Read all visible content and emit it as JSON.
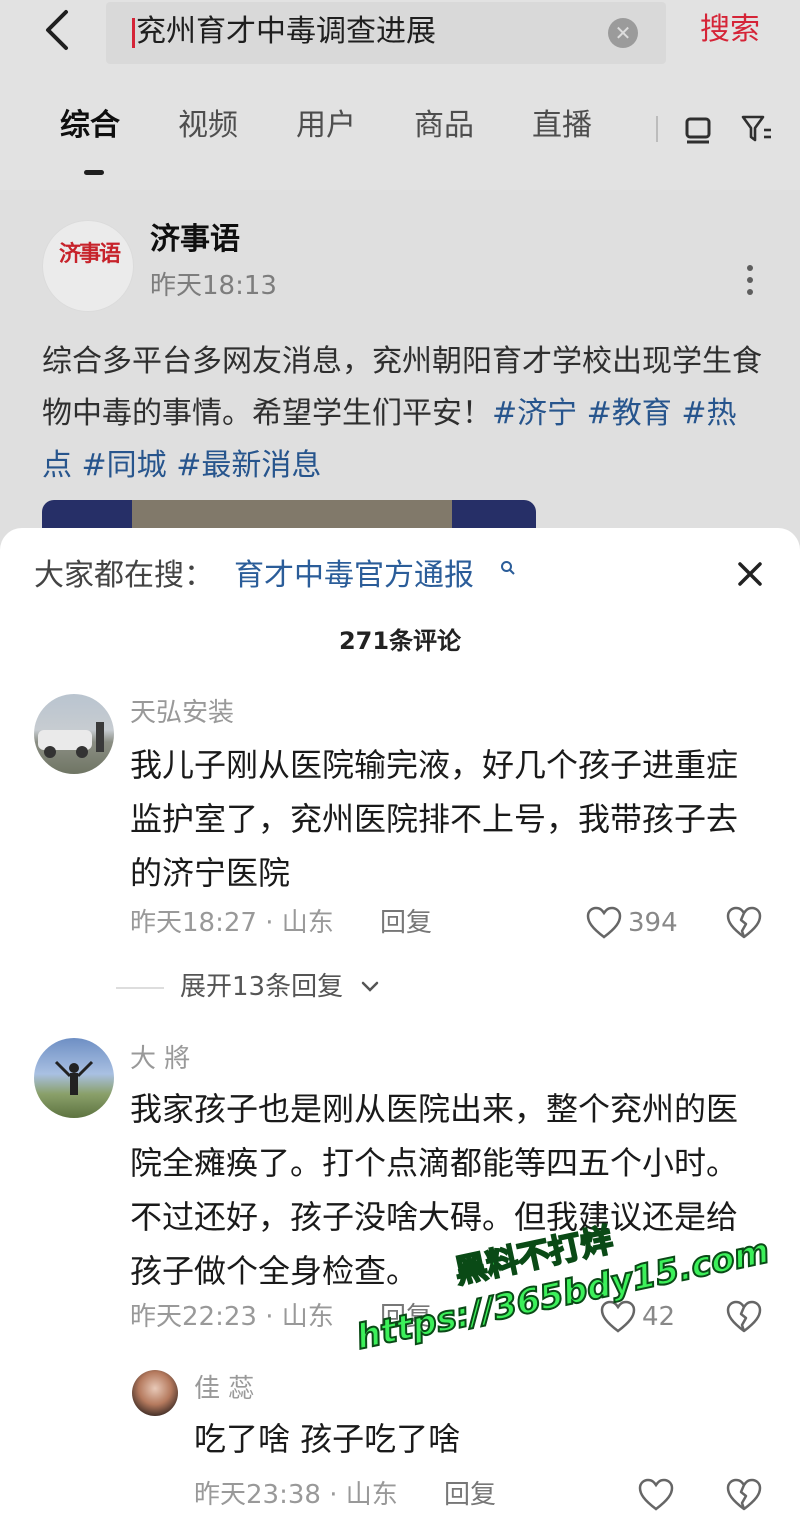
{
  "search": {
    "query": "兖州育才中毒调查进展",
    "clear_icon": "clear-icon",
    "button_label": "搜索"
  },
  "tabs": [
    {
      "label": "综合",
      "active": true
    },
    {
      "label": "视频",
      "active": false
    },
    {
      "label": "用户",
      "active": false
    },
    {
      "label": "商品",
      "active": false
    },
    {
      "label": "直播",
      "active": false
    }
  ],
  "post": {
    "author": "济事语",
    "avatar_text": "济事语",
    "time": "昨天18:13",
    "text": "综合多平台多网友消息，兖州朝阳育才学校出现学生食物中毒的事情。希望学生们平安！",
    "tags": "#济宁 #教育 #热点 #同城 #最新消息"
  },
  "sheet": {
    "trending_label": "大家都在搜：",
    "trending_link": "育才中毒官方通报",
    "comment_count": "271条评论"
  },
  "comments": [
    {
      "author": "天弘安装",
      "text": "我儿子刚从医院输完液，好几个孩子进重症监护室了，兖州医院排不上号，我带孩子去的济宁医院",
      "time_location": "昨天18:27 · 山东",
      "reply_label": "回复",
      "likes": "394",
      "expand_label": "展开13条回复"
    },
    {
      "author": "大 將",
      "text": "我家孩子也是刚从医院出来，整个兖州的医院全瘫痪了。打个点滴都能等四五个小时。不过还好，孩子没啥大碍。但我建议还是给孩子做个全身检查。",
      "time_location": "昨天22:23 · 山东",
      "reply_label": "回复",
      "likes": "42"
    },
    {
      "author": "佳 蕊",
      "text": "吃了啥 孩子吃了啥",
      "time_location": "昨天23:38 · 山东",
      "reply_label": "回复",
      "likes": ""
    }
  ],
  "watermark": {
    "line1": "黑料不打烊",
    "line2": "https://365bdy15.com"
  },
  "colors": {
    "accent_red": "#e8283c",
    "link_blue": "#2b5d99"
  }
}
